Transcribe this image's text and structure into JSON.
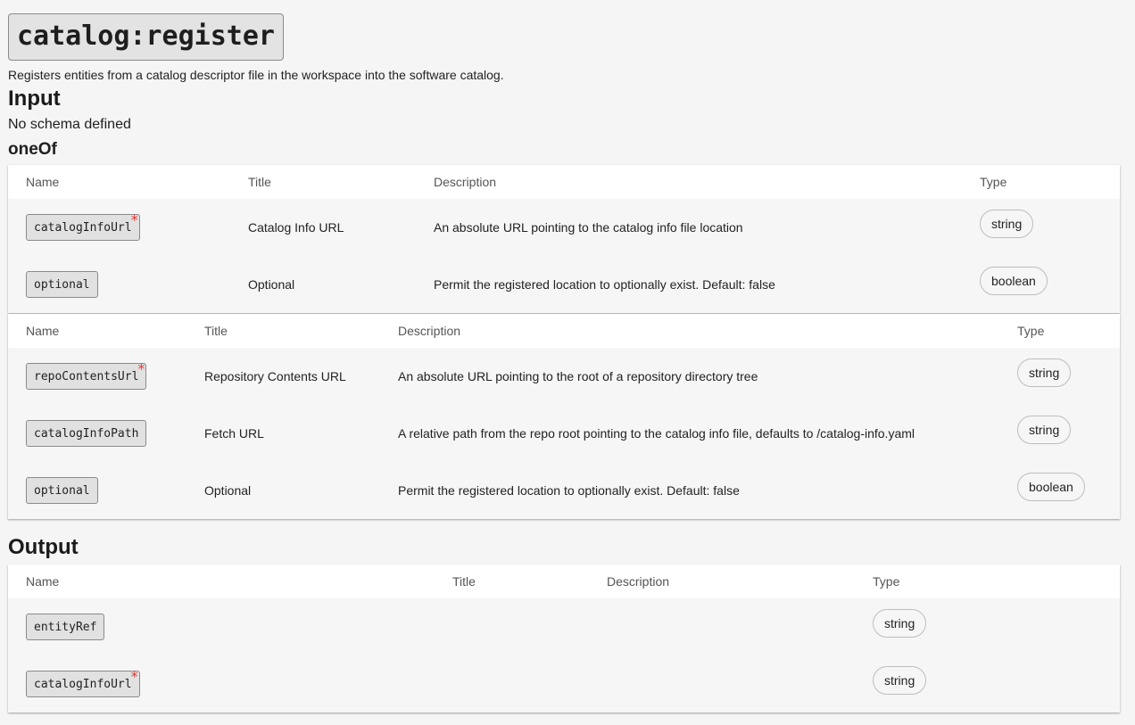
{
  "action": {
    "title": "catalog:register",
    "description": "Registers entities from a catalog descriptor file in the workspace into the software catalog."
  },
  "input": {
    "heading": "Input",
    "no_schema": "No schema defined",
    "one_of_heading": "oneOf",
    "tables": [
      {
        "headers": [
          "Name",
          "Title",
          "Description",
          "Type"
        ],
        "rows": [
          {
            "name": "catalogInfoUrl",
            "required": "*",
            "title": "Catalog Info URL",
            "description": "An absolute URL pointing to the catalog info file location",
            "type": "string"
          },
          {
            "name": "optional",
            "required": "",
            "title": "Optional",
            "description": "Permit the registered location to optionally exist. Default: false",
            "type": "boolean"
          }
        ]
      },
      {
        "headers": [
          "Name",
          "Title",
          "Description",
          "Type"
        ],
        "rows": [
          {
            "name": "repoContentsUrl",
            "required": "*",
            "title": "Repository Contents URL",
            "description": "An absolute URL pointing to the root of a repository directory tree",
            "type": "string"
          },
          {
            "name": "catalogInfoPath",
            "required": "",
            "title": "Fetch URL",
            "description": "A relative path from the repo root pointing to the catalog info file, defaults to /catalog-info.yaml",
            "type": "string"
          },
          {
            "name": "optional",
            "required": "",
            "title": "Optional",
            "description": "Permit the registered location to optionally exist. Default: false",
            "type": "boolean"
          }
        ]
      }
    ]
  },
  "output": {
    "heading": "Output",
    "table": {
      "headers": [
        "Name",
        "Title",
        "Description",
        "Type"
      ],
      "rows": [
        {
          "name": "entityRef",
          "required": "",
          "title": "",
          "description": "",
          "type": "string"
        },
        {
          "name": "catalogInfoUrl",
          "required": "*",
          "title": "",
          "description": "",
          "type": "string"
        }
      ]
    }
  },
  "colors": {
    "required_marker": "#e53935",
    "page_background": "#f5f5f5",
    "header_row_background": "#ffffff"
  }
}
